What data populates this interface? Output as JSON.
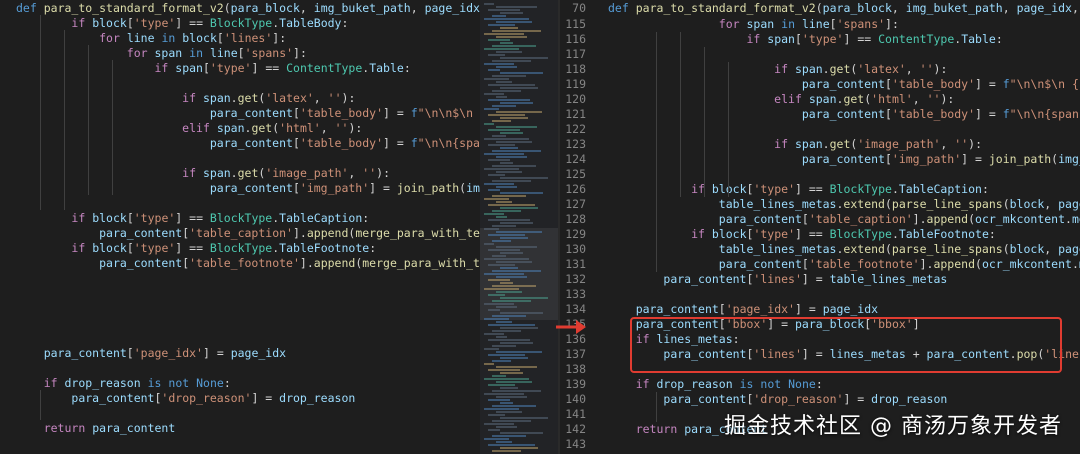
{
  "left_pane": {
    "lines": [
      "def para_to_standard_format_v2(para_block, img_buket_path, page_idx, drop_rea",
      "        if block['type'] == BlockType.TableBody:",
      "            for line in block['lines']:",
      "                for span in line['spans']:",
      "                    if span['type'] == ContentType.Table:",
      "",
      "                        if span.get('latex', ''):",
      "                            para_content['table_body'] = f\"\\n\\n$\\n {span[",
      "                        elif span.get('html', ''):",
      "                            para_content['table_body'] = f\"\\n\\n{span['htm",
      "",
      "                        if span.get('image_path', ''):",
      "                            para_content['img_path'] = join_path(img_buke",
      "",
      "        if block['type'] == BlockType.TableCaption:",
      "            para_content['table_caption'].append(merge_para_with_text(blo",
      "        if block['type'] == BlockType.TableFootnote:",
      "            para_content['table_footnote'].append(merge_para_with_text(bl",
      "",
      "",
      "",
      "",
      "",
      "    para_content['page_idx'] = page_idx",
      "",
      "    if drop_reason is not None:",
      "        para_content['drop_reason'] = drop_reason",
      "",
      "    return para_content"
    ]
  },
  "right_pane": {
    "header_line_no": "70",
    "header": "def para_to_standard_format_v2(para_block, img_buket_path, page_idx, drop_rea",
    "lines": [
      {
        "no": "115",
        "text": "                for span in line['spans']:"
      },
      {
        "no": "116",
        "text": "                    if span['type'] == ContentType.Table:"
      },
      {
        "no": "117",
        "text": ""
      },
      {
        "no": "118",
        "text": "                        if span.get('latex', ''):"
      },
      {
        "no": "119",
        "text": "                            para_content['table_body'] = f\"\\n\\n$\\n {span["
      },
      {
        "no": "120",
        "text": "                        elif span.get('html', ''):"
      },
      {
        "no": "121",
        "text": "                            para_content['table_body'] = f\"\\n\\n{span['htm"
      },
      {
        "no": "122",
        "text": ""
      },
      {
        "no": "123",
        "text": "                        if span.get('image_path', ''):"
      },
      {
        "no": "124",
        "text": "                            para_content['img_path'] = join_path(img_buke"
      },
      {
        "no": "125",
        "text": ""
      },
      {
        "no": "126",
        "text": "            if block['type'] == BlockType.TableCaption:"
      },
      {
        "no": "127",
        "text": "                table_lines_metas.extend(parse_line_spans(block, page_idx))"
      },
      {
        "no": "128",
        "text": "                para_content['table_caption'].append(ocr_mkcontent.merge_para"
      },
      {
        "no": "129",
        "text": "            if block['type'] == BlockType.TableFootnote:"
      },
      {
        "no": "130",
        "text": "                table_lines_metas.extend(parse_line_spans(block, page_idx))"
      },
      {
        "no": "131",
        "text": "                para_content['table_footnote'].append(ocr_mkcontent.merge_par"
      },
      {
        "no": "132",
        "text": "        para_content['lines'] = table_lines_metas"
      },
      {
        "no": "133",
        "text": ""
      },
      {
        "no": "134",
        "text": "    para_content['page_idx'] = page_idx"
      },
      {
        "no": "135",
        "text": "    para_content['bbox'] = para_block['bbox']"
      },
      {
        "no": "136",
        "text": "    if lines_metas:"
      },
      {
        "no": "137",
        "text": "        para_content['lines'] = lines_metas + para_content.pop('lines', [])"
      },
      {
        "no": "138",
        "text": ""
      },
      {
        "no": "139",
        "text": "    if drop_reason is not None:"
      },
      {
        "no": "140",
        "text": "        para_content['drop_reason'] = drop_reason"
      },
      {
        "no": "141",
        "text": ""
      },
      {
        "no": "142",
        "text": "    return para_content"
      },
      {
        "no": "143",
        "text": ""
      }
    ]
  },
  "watermark": "掘金技术社区 @ 商汤万象开发者",
  "colors": {
    "background": "#1e1e1e",
    "keyword": "#569cd6",
    "control": "#c586c0",
    "function": "#dcdcaa",
    "class": "#4ec9b0",
    "string": "#ce9178",
    "variable": "#9cdcfe",
    "highlight_box": "#e03c31",
    "arrow": "#e03c31"
  },
  "icons": [
    "arrow-right-icon"
  ]
}
